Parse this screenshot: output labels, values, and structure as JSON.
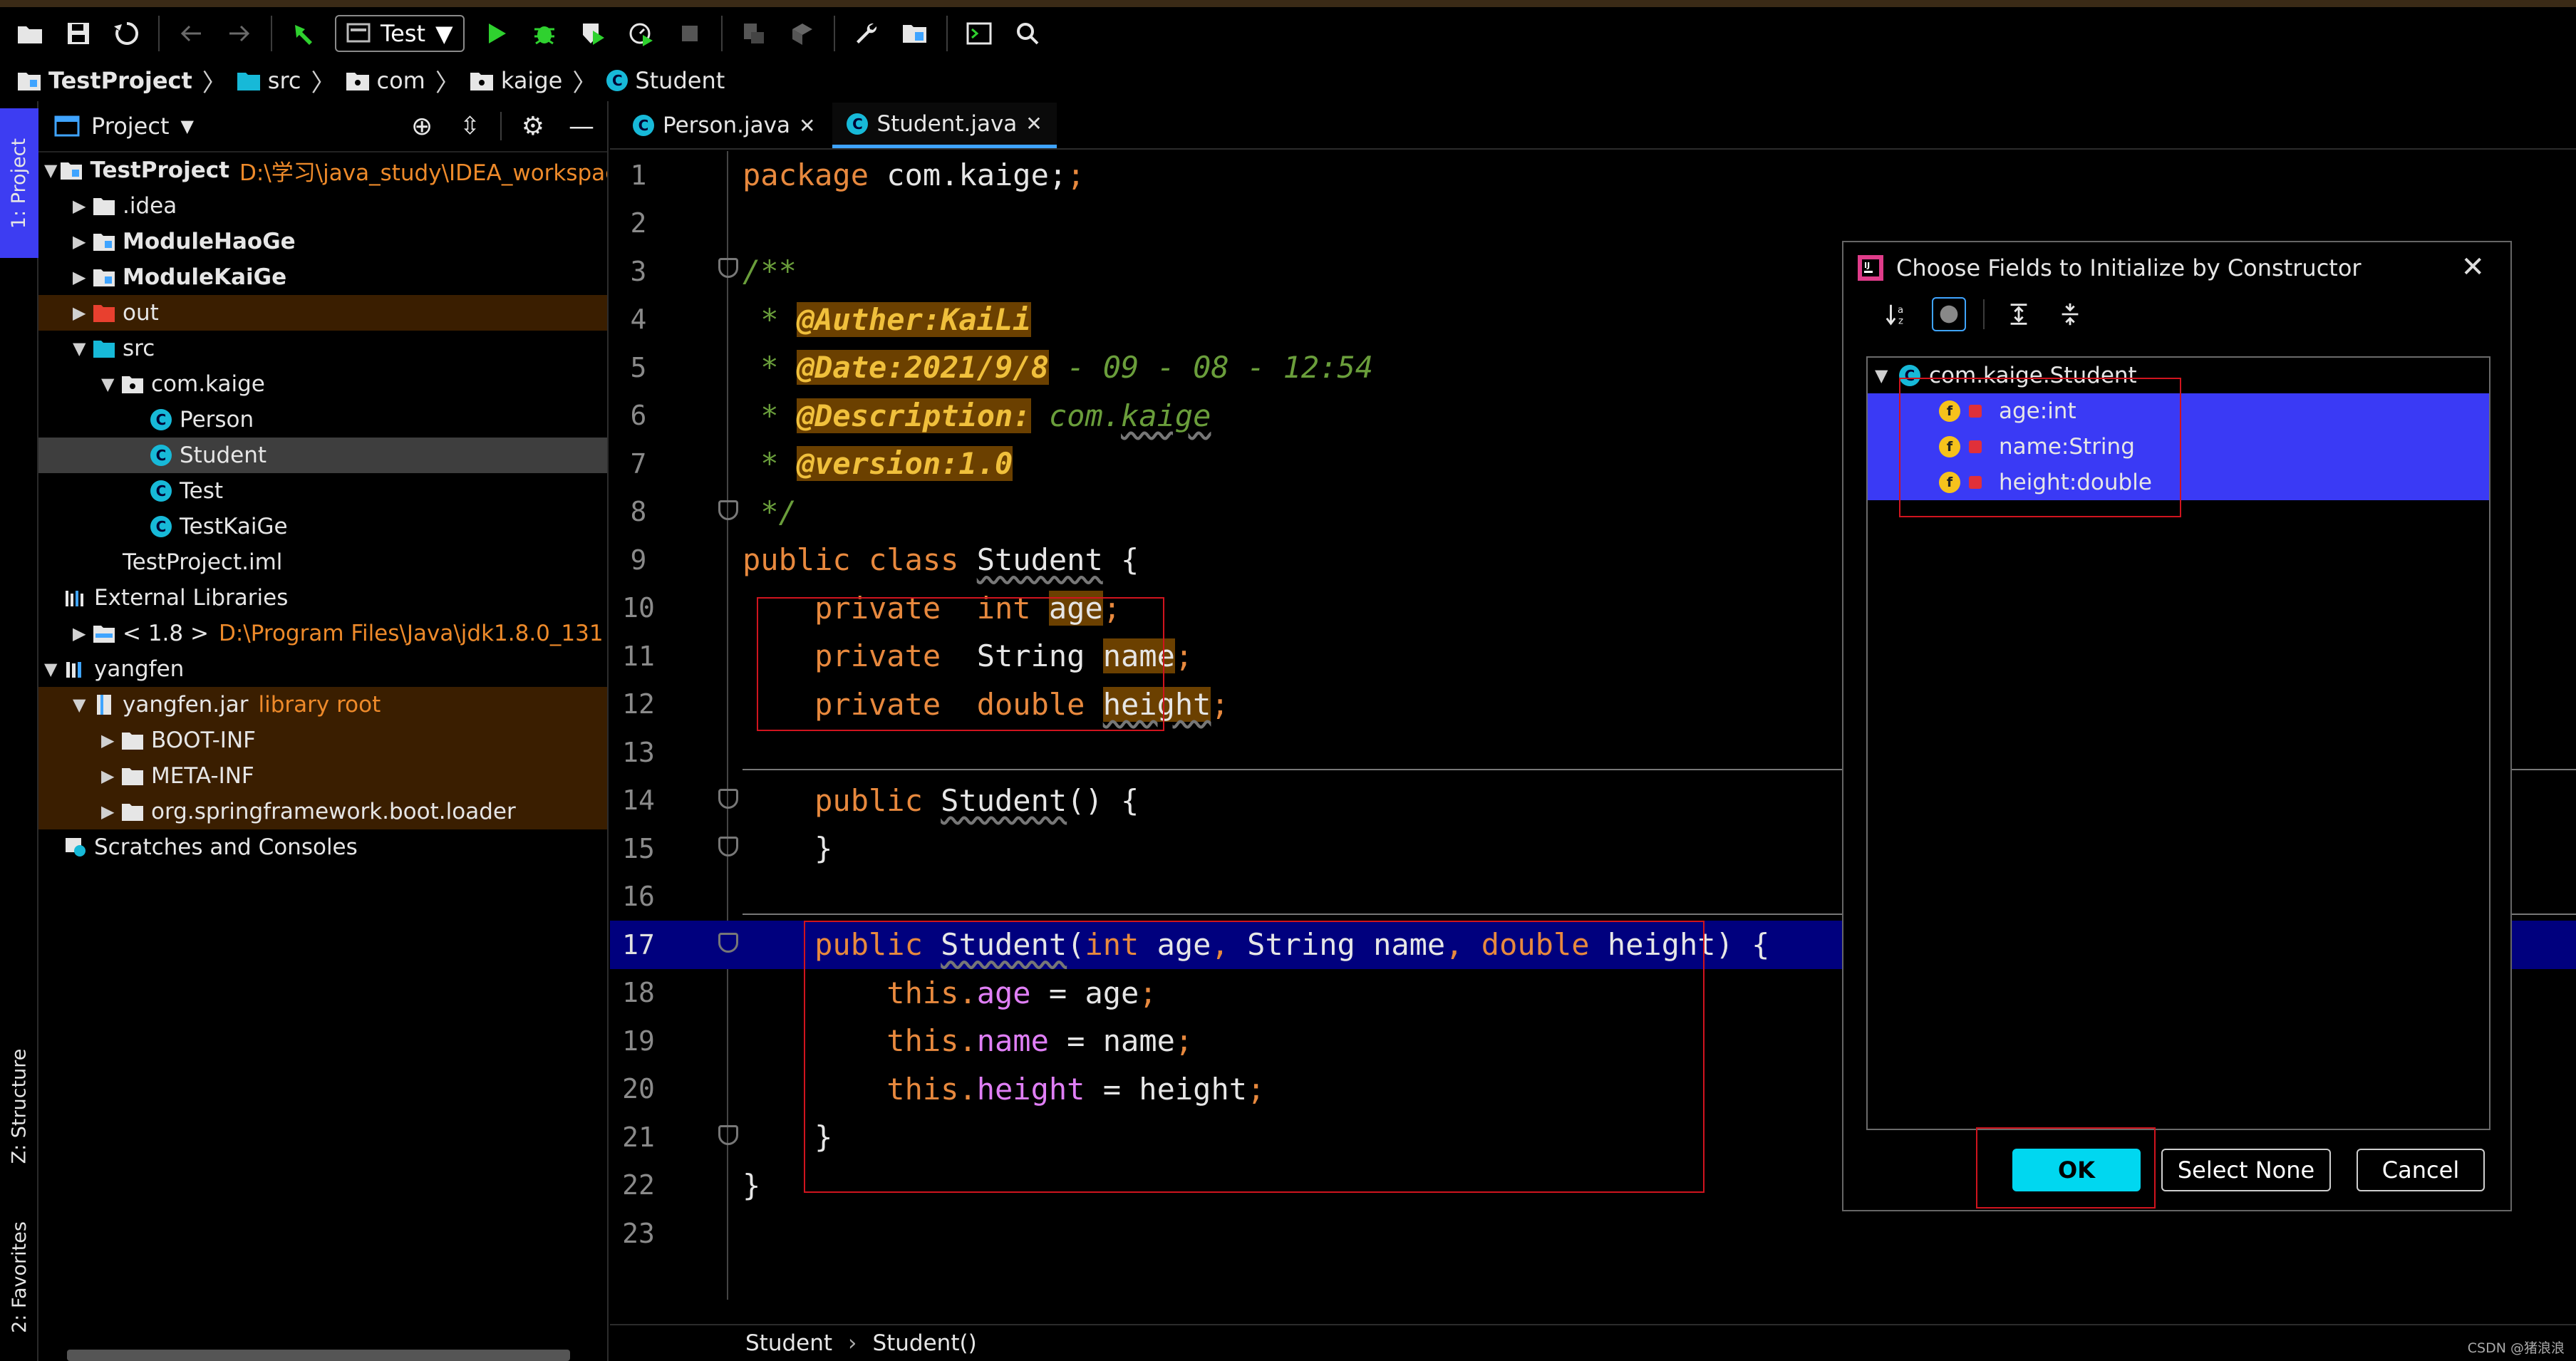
{
  "toolbar": {
    "run_config": "Test",
    "icons": [
      "open-folder-icon",
      "save-icon",
      "sync-icon",
      "back-icon",
      "forward-icon",
      "build-hammer-icon",
      "run-icon",
      "debug-icon",
      "coverage-icon",
      "profile-icon",
      "stop-icon",
      "attach-icon",
      "deploy-icon",
      "settings-wrench-icon",
      "project-structure-icon",
      "terminal-icon",
      "search-icon"
    ]
  },
  "breadcrumb": [
    "TestProject",
    "src",
    "com",
    "kaige",
    "Student"
  ],
  "left_strip": {
    "project_tab": "1: Project",
    "structure_tab": "Z: Structure",
    "favorites_tab": "2: Favorites"
  },
  "project_panel": {
    "title": "Project",
    "tree": [
      {
        "label": "TestProject",
        "extra": "D:\\学习\\java_study\\IDEA_workspace\\Te",
        "level": 0,
        "arrow": "▼",
        "icon": "module-folder-icon",
        "bold": true
      },
      {
        "label": ".idea",
        "level": 1,
        "arrow": "▶",
        "icon": "folder-icon"
      },
      {
        "label": "ModuleHaoGe",
        "level": 1,
        "arrow": "▶",
        "icon": "module-folder-icon",
        "bold": true
      },
      {
        "label": "ModuleKaiGe",
        "level": 1,
        "arrow": "▶",
        "icon": "module-folder-icon",
        "bold": true
      },
      {
        "label": "out",
        "level": 1,
        "arrow": "▶",
        "icon": "excluded-folder-icon",
        "highlight": "orange"
      },
      {
        "label": "src",
        "level": 1,
        "arrow": "▼",
        "icon": "source-folder-icon"
      },
      {
        "label": "com.kaige",
        "level": 2,
        "arrow": "▼",
        "icon": "package-icon"
      },
      {
        "label": "Person",
        "level": 3,
        "arrow": "",
        "icon": "class-icon"
      },
      {
        "label": "Student",
        "level": 3,
        "arrow": "",
        "icon": "class-icon",
        "selected": true
      },
      {
        "label": "Test",
        "level": 3,
        "arrow": "",
        "icon": "class-icon"
      },
      {
        "label": "TestKaiGe",
        "level": 3,
        "arrow": "",
        "icon": "class-icon"
      },
      {
        "label": "TestProject.iml",
        "level": 1,
        "arrow": "",
        "icon": "iml-file-icon"
      },
      {
        "label": "External Libraries",
        "level": 0,
        "arrow": "",
        "icon": "libraries-icon"
      },
      {
        "label": "< 1.8 >",
        "extra": "D:\\Program Files\\Java\\jdk1.8.0_131",
        "level": 1,
        "arrow": "▶",
        "icon": "jdk-folder-icon"
      },
      {
        "label": "yangfen",
        "level": 0,
        "arrow": "▼",
        "icon": "library-icon"
      },
      {
        "label": "yangfen.jar",
        "extra": "library root",
        "level": 1,
        "arrow": "▼",
        "icon": "jar-icon",
        "highlight": "orange"
      },
      {
        "label": "BOOT-INF",
        "level": 2,
        "arrow": "▶",
        "icon": "folder-icon",
        "highlight": "orange"
      },
      {
        "label": "META-INF",
        "level": 2,
        "arrow": "▶",
        "icon": "folder-icon",
        "highlight": "orange"
      },
      {
        "label": "org.springframework.boot.loader",
        "level": 2,
        "arrow": "▶",
        "icon": "folder-icon",
        "highlight": "orange"
      },
      {
        "label": "Scratches and Consoles",
        "level": 0,
        "arrow": "",
        "icon": "scratches-icon"
      }
    ]
  },
  "editor": {
    "tabs": [
      {
        "label": "Person.java",
        "active": false
      },
      {
        "label": "Student.java",
        "active": true
      }
    ],
    "line_numbers": [
      "1",
      "2",
      "3",
      "4",
      "5",
      "6",
      "7",
      "8",
      "9",
      "10",
      "11",
      "12",
      "13",
      "14",
      "15",
      "16",
      "17",
      "18",
      "19",
      "20",
      "21",
      "22",
      "23"
    ],
    "current_line": "17",
    "footer": {
      "class_crumb": "Student",
      "method_crumb": "Student()"
    }
  },
  "code": {
    "l1_kw": "package",
    "l1_rest": " com.kaige;",
    "l3": "/**",
    "l4_star": " * ",
    "l4_tag": "@Auther:KaiLi",
    "l5_star": " * ",
    "l5_tag": "@Date:2021/9/8",
    "l5_rest": " - 09 - 08 - 12:54",
    "l6_star": " * ",
    "l6_tag": "@Description:",
    "l6_rest_a": " com.",
    "l6_rest_b": "kaige",
    "l7_star": " * ",
    "l7_tag": "@version:1.0",
    "l8": " */",
    "l9_kw": "public class ",
    "l9_name": "Student",
    "l9_rest": " {",
    "l10_kw": "    private  int ",
    "l10_var": "age",
    "l10_end": ";",
    "l11_kw": "    private  ",
    "l11_type": "String ",
    "l11_var": "name",
    "l11_end": ";",
    "l12_kw": "    private  double ",
    "l12_var": "height",
    "l12_end": ";",
    "l14_kw": "    public ",
    "l14_name": "Student",
    "l14_rest": "() {",
    "l15": "    }",
    "l17_kw": "    public ",
    "l17_name": "Student",
    "l17_p1": "(",
    "l17_t1": "int",
    "l17_p2": " age",
    "l17_c1": ",",
    "l17_p3": " String name",
    "l17_c2": ",",
    "l17_t2": " double",
    "l17_p4": " height) {",
    "l18_this": "        this.",
    "l18_fld": "age",
    "l18_rest": " = age",
    "l18_end": ";",
    "l19_this": "        this.",
    "l19_fld": "name",
    "l19_rest": " = name",
    "l19_end": ";",
    "l20_this": "        this.",
    "l20_fld": "height",
    "l20_rest": " = height",
    "l20_end": ";",
    "l21": "    }",
    "l22": "}"
  },
  "dialog": {
    "title": "Choose Fields to Initialize by Constructor",
    "root": "com.kaige.Student",
    "fields": [
      "age:int",
      "name:String",
      "height:double"
    ],
    "buttons": {
      "ok": "OK",
      "select_none": "Select None",
      "cancel": "Cancel"
    }
  },
  "watermark": "CSDN @猪浪浪"
}
